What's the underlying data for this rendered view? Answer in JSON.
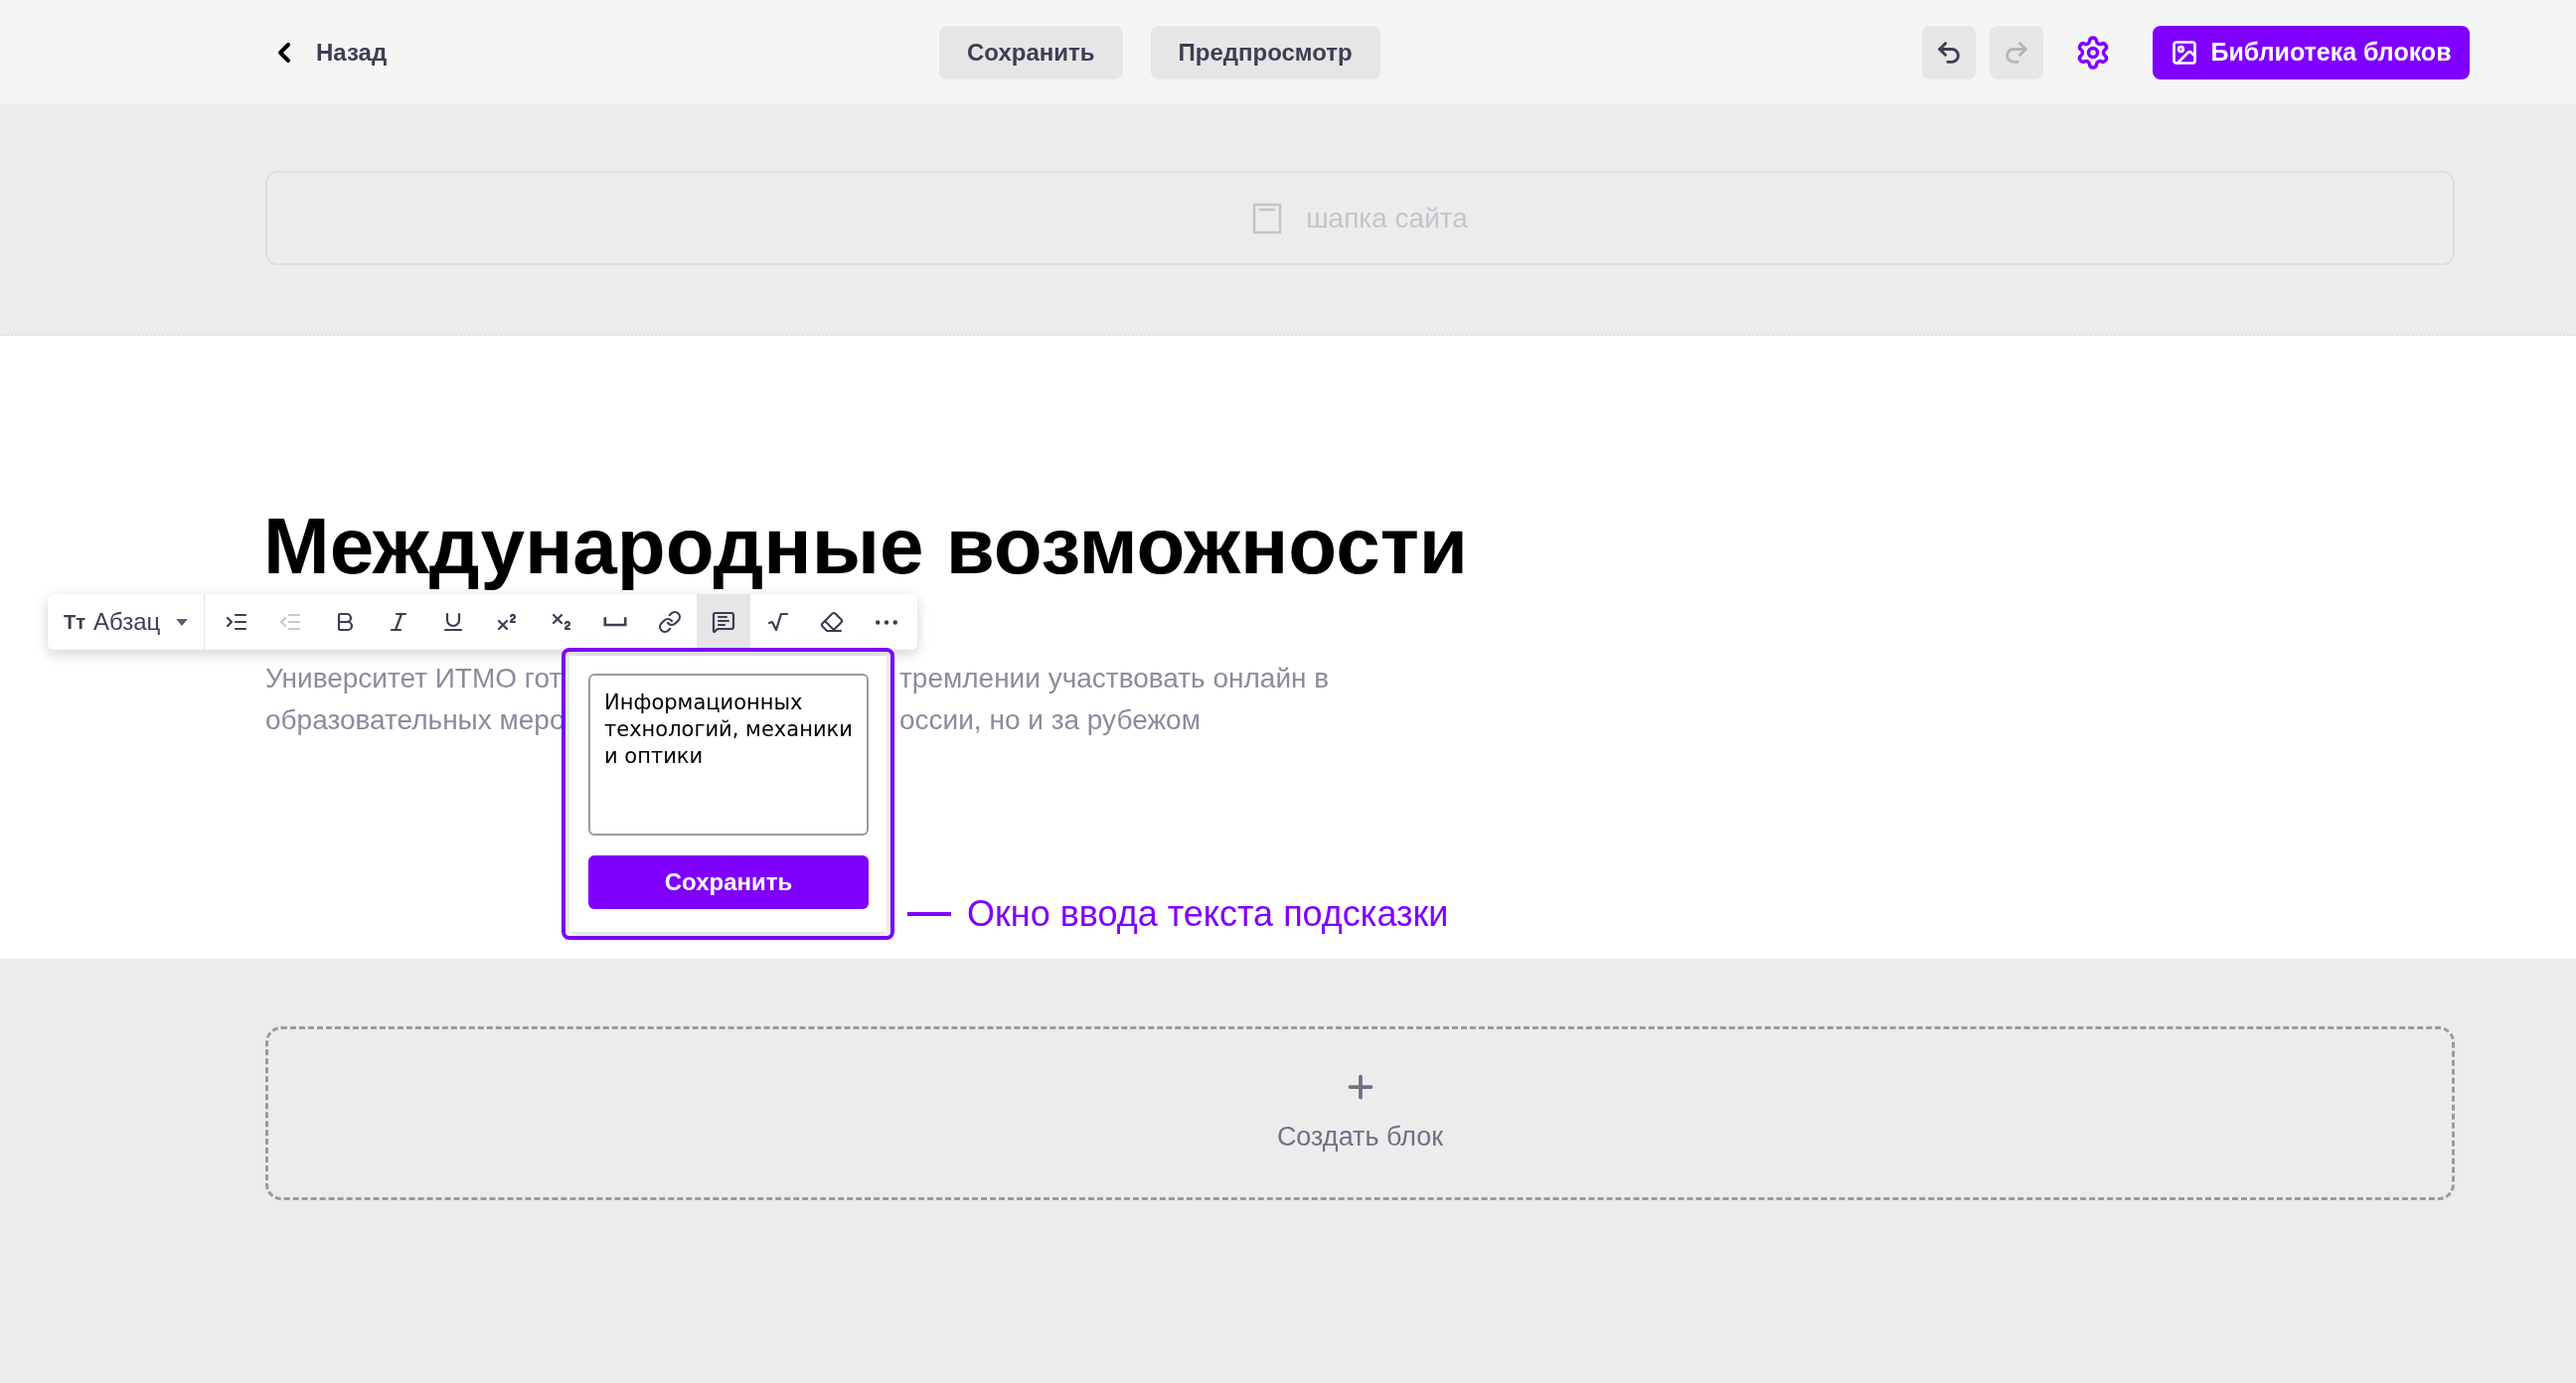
{
  "top_bar": {
    "back": {
      "label": "Назад"
    },
    "center_buttons": [
      {
        "label": "Сохранить"
      },
      {
        "label": "Предпросмотр"
      }
    ],
    "history": [
      {
        "kind": "undo",
        "disabled": false
      },
      {
        "kind": "redo",
        "disabled": true
      }
    ],
    "library_button": {
      "label": "Библиотека блоков"
    }
  },
  "header_block": {
    "label": "шапка сайта"
  },
  "page": {
    "title": "Международные возможности",
    "paragraph_lines": [
      {
        "left": "Университет ИТМО гот",
        "right": "тремлении участвовать онлайн в"
      },
      {
        "left": "образовательных меро",
        "right": "оссии, но и за рубежом"
      }
    ]
  },
  "format_toolbar": {
    "style_select": {
      "icon_text": "Tт",
      "value": "Абзац"
    },
    "buttons": [
      {
        "kind": "indent",
        "disabled": false,
        "selected": false
      },
      {
        "kind": "outdent",
        "disabled": true,
        "selected": false
      },
      {
        "kind": "bold",
        "disabled": false,
        "selected": false
      },
      {
        "kind": "italic",
        "disabled": false,
        "selected": false
      },
      {
        "kind": "underline",
        "disabled": false,
        "selected": false
      },
      {
        "kind": "superscript",
        "disabled": false,
        "selected": false
      },
      {
        "kind": "subscript",
        "disabled": false,
        "selected": false
      },
      {
        "kind": "space",
        "disabled": false,
        "selected": false
      },
      {
        "kind": "link",
        "disabled": false,
        "selected": false
      },
      {
        "kind": "tooltip",
        "disabled": false,
        "selected": true
      },
      {
        "kind": "formula",
        "disabled": false,
        "selected": false
      },
      {
        "kind": "eraser",
        "disabled": false,
        "selected": false
      },
      {
        "kind": "more",
        "disabled": false,
        "selected": false
      }
    ]
  },
  "tooltip_popup": {
    "value": "Информационных технологий, механики и оптики",
    "save_button": "Сохранить"
  },
  "annotation": "Окно ввода текста подсказки",
  "create_block": {
    "label": "Создать блок"
  }
}
